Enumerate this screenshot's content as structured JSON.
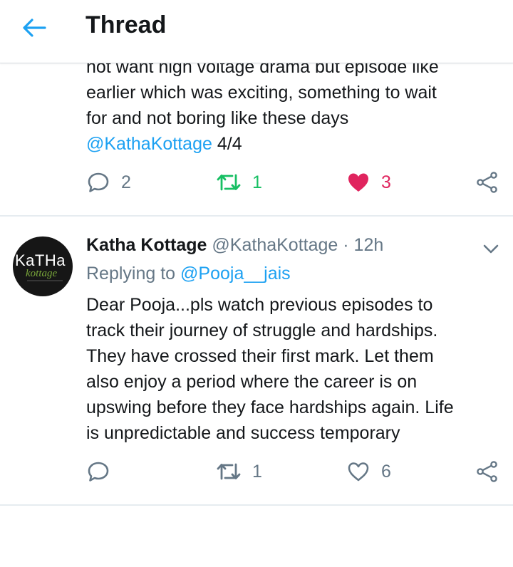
{
  "header": {
    "title": "Thread"
  },
  "tweet1": {
    "lines": [
      "not want high voltage drama but episode like",
      "earlier which was exciting, something to wait",
      "for and not boring like these days"
    ],
    "mention": "@KathaKottage",
    "suffix": " 4/4",
    "replies": "2",
    "retweets": "1",
    "likes": "3"
  },
  "tweet2": {
    "avatar_top": "KaTHa",
    "avatar_script": "kottage",
    "display_name": "Katha Kottage",
    "handle": "@KathaKottage",
    "dot": " · ",
    "time": "12h",
    "replying_prefix": "Replying to ",
    "replying_to": "@Pooja__jais",
    "lines": [
      "Dear Pooja...pls watch previous episodes to",
      "track their journey of struggle and hardships.",
      "They have crossed their first mark. Let them",
      "also enjoy a period where the career is on",
      "upswing before they face hardships again. Life",
      "is unpredictable and success temporary"
    ],
    "replies": "",
    "retweets": "1",
    "likes": "6"
  },
  "colors": {
    "accent": "#1da1f2",
    "retweet_active": "#17bf63",
    "like_active": "#e0245e",
    "icon_gray": "#657786",
    "separator": "#e6ecf0"
  }
}
